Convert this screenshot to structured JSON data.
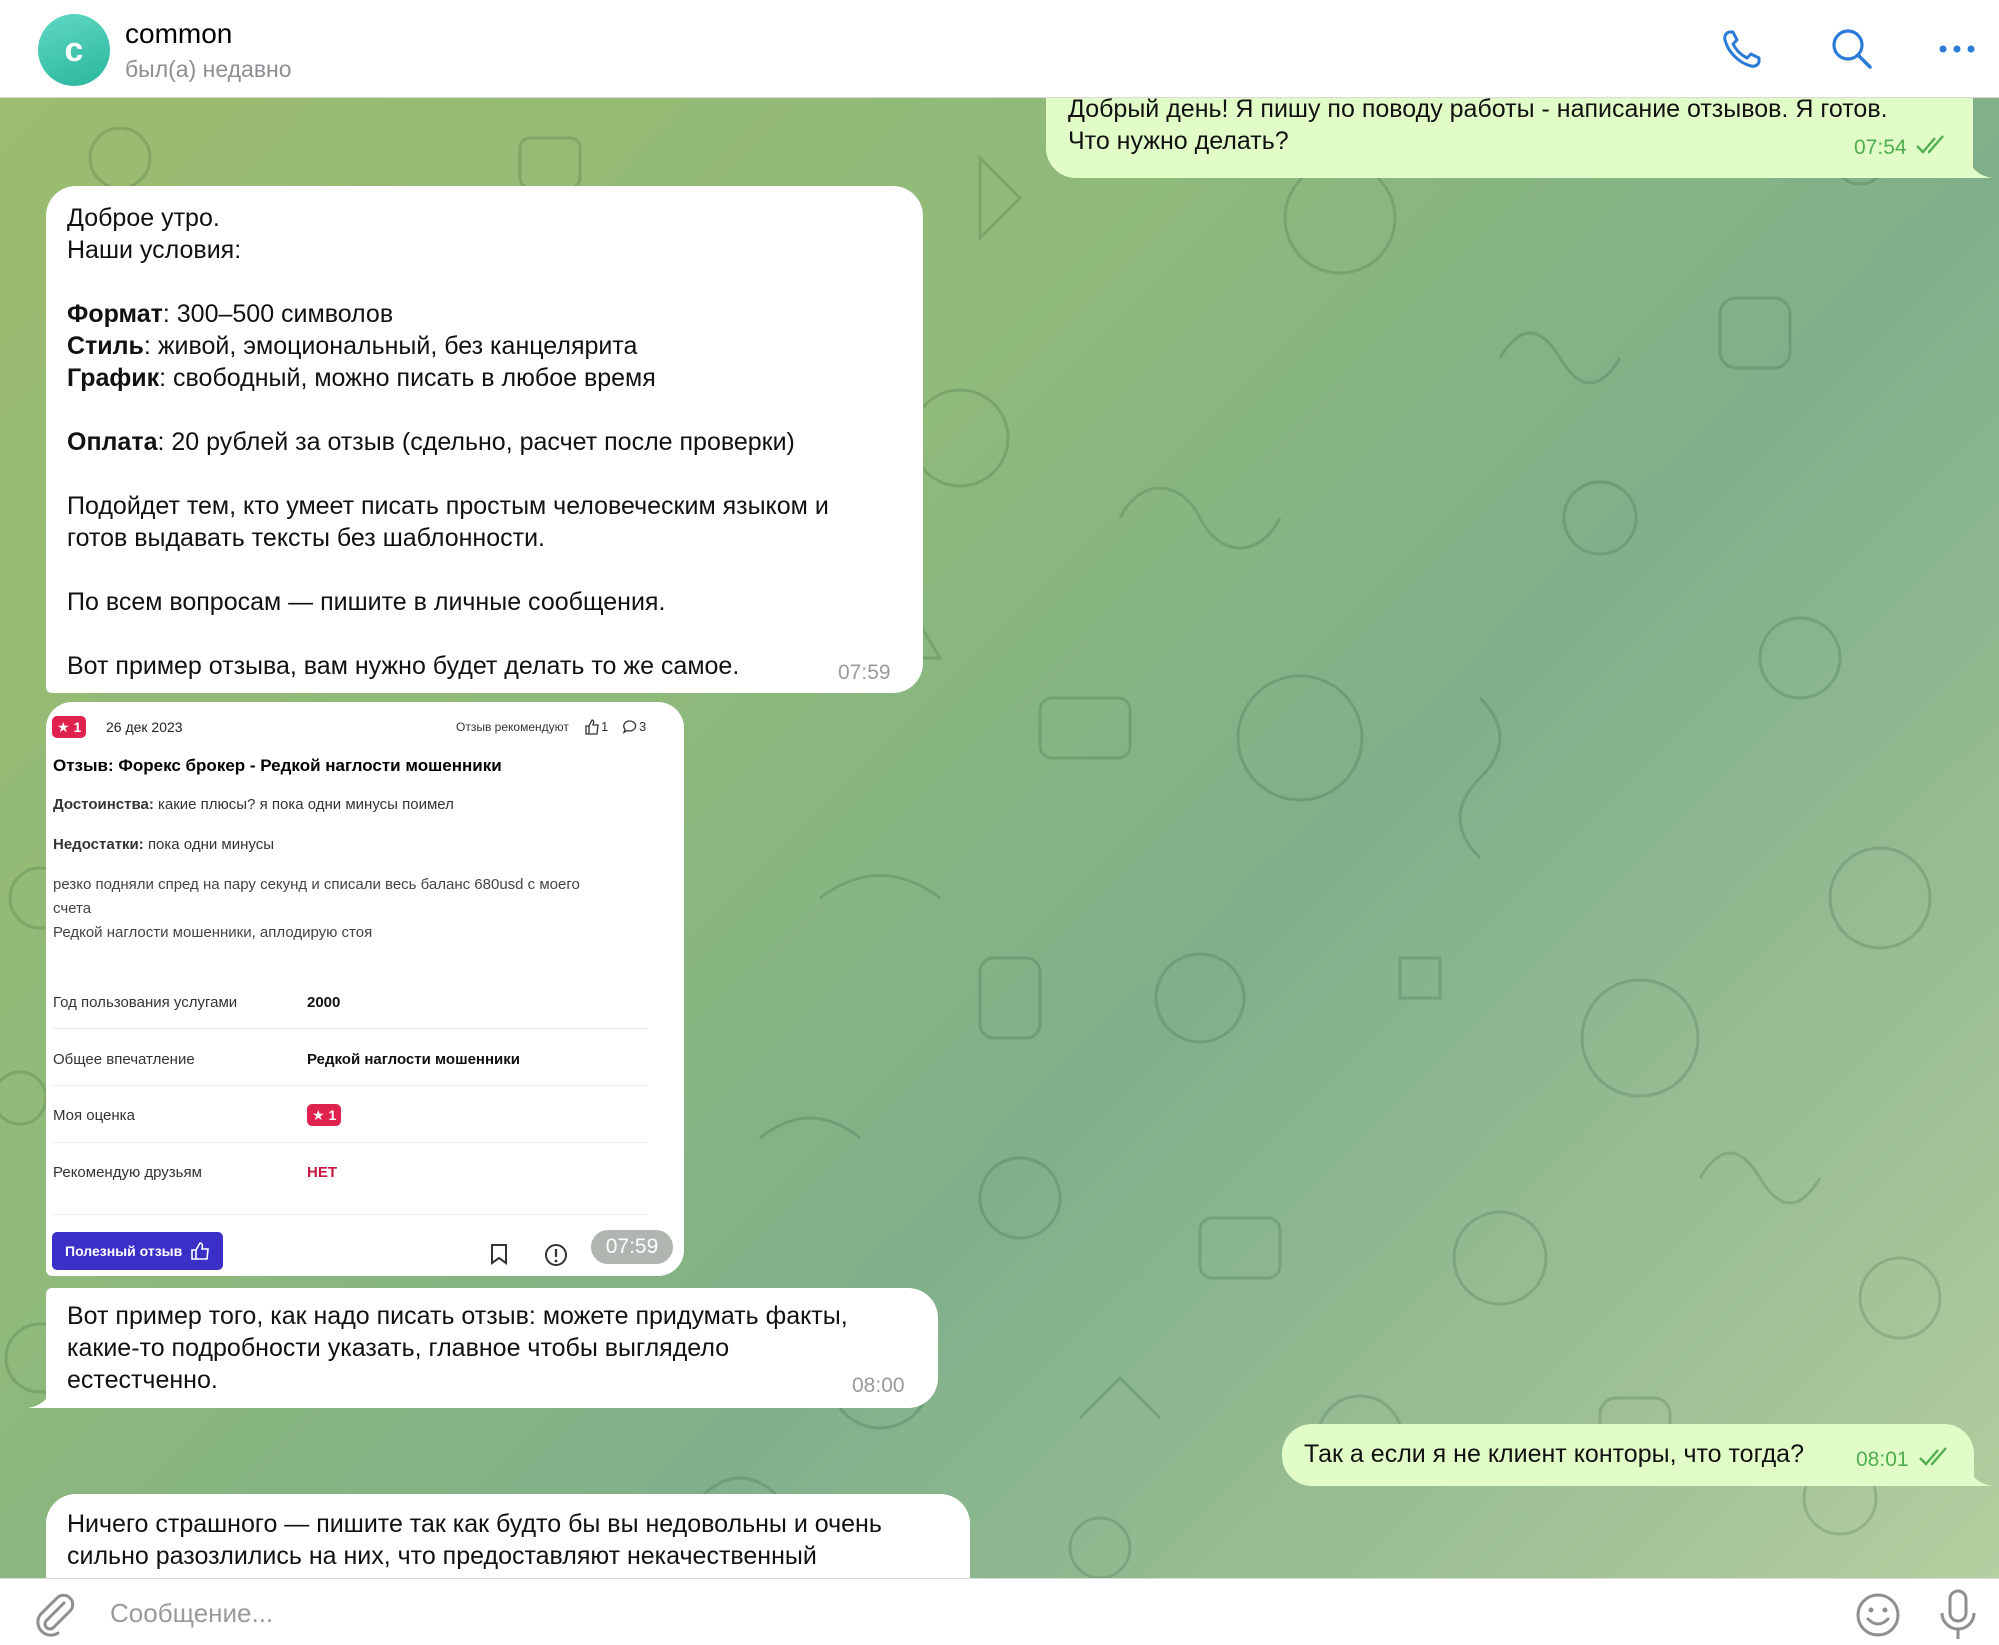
{
  "header": {
    "avatar_letter": "c",
    "title": "common",
    "status": "был(а) недавно",
    "icons": [
      "phone-icon",
      "search-icon",
      "more-icon"
    ]
  },
  "messages": [
    {
      "id": "m1",
      "direction": "out",
      "lines": [
        "Добрый день! Я пишу по поводу работы - написание отзывов. Я готов.",
        "Что нужно делать?"
      ],
      "time": "07:54",
      "read": true
    },
    {
      "id": "m2",
      "direction": "in",
      "greeting": "Доброе утро.",
      "intro": "Наши условия:",
      "format_label": "Формат",
      "format_value": ": 300–500 символов",
      "style_label": "Стиль",
      "style_value": ": живой, эмоциональный, без канцелярита",
      "schedule_label": "График",
      "schedule_value": ": свободный, можно писать в любое время",
      "pay_label": "Оплата",
      "pay_value": ": 20 рублей за отзыв (сдельно, расчет после проверки)",
      "fit_line1": "Подойдет тем, кто умеет писать простым человеческим языком и",
      "fit_line2": "готов выдавать тексты без шаблонности.",
      "questions": "По всем вопросам — пишите в личные сообщения.",
      "example": "Вот пример отзыва, вам нужно будет делать то же самое.",
      "time": "07:59"
    },
    {
      "id": "m3",
      "direction": "in",
      "type": "image",
      "time": "07:59",
      "review": {
        "rating": "1",
        "date": "26 дек 2023",
        "recommend_label": "Отзыв рекомендуют",
        "likes": "1",
        "comments": "3",
        "title": "Отзыв: Форекс брокер  - Редкой наглости мошенники",
        "pros_label": "Достоинства:",
        "pros": "какие плюсы? я пока одни минусы поимел",
        "cons_label": "Недостатки:",
        "cons": "пока одни минусы",
        "body_line1": "резко подняли спред на пару секунд и списали весь баланс 680usd с моего",
        "body_line2": "счета",
        "body_line3": "Редкой наглости мошенники, аплодирую стоя",
        "rows": [
          {
            "label": "Год пользования услугами",
            "value": "2000"
          },
          {
            "label": "Общее впечатление",
            "value": "Редкой наглости мошенники"
          },
          {
            "label": "Моя оценка",
            "value": "1"
          },
          {
            "label": "Рекомендую друзьям",
            "value": "НЕТ"
          }
        ],
        "useful_button": "Полезный отзыв"
      }
    },
    {
      "id": "m4",
      "direction": "in",
      "lines": [
        "Вот пример того, как надо писать отзыв: можете придумать факты,",
        "какие-то подробности указать, главное чтобы выглядело",
        "естестченно."
      ],
      "time": "08:00"
    },
    {
      "id": "m5",
      "direction": "out",
      "lines": [
        "Так а если я не клиент конторы, что тогда?"
      ],
      "time": "08:01",
      "read": true
    },
    {
      "id": "m6",
      "direction": "in",
      "lines": [
        "Ничего страшного — пишите так как будто бы вы недовольны и очень",
        "сильно разозлились на них, что предоставляют некачественный"
      ]
    }
  ],
  "composer": {
    "placeholder": "Сообщение...",
    "icons": [
      "attach-icon",
      "emoji-icon",
      "microphone-icon"
    ]
  },
  "colors": {
    "accent": "#2a7bd8",
    "outgoing_bubble": "#e2fcc8",
    "incoming_bubble": "#ffffff",
    "time_out": "#4fae4e",
    "avatar": "#3dc3ad",
    "rating_badge": "#e0234e",
    "useful_button": "#3a2fc7"
  }
}
